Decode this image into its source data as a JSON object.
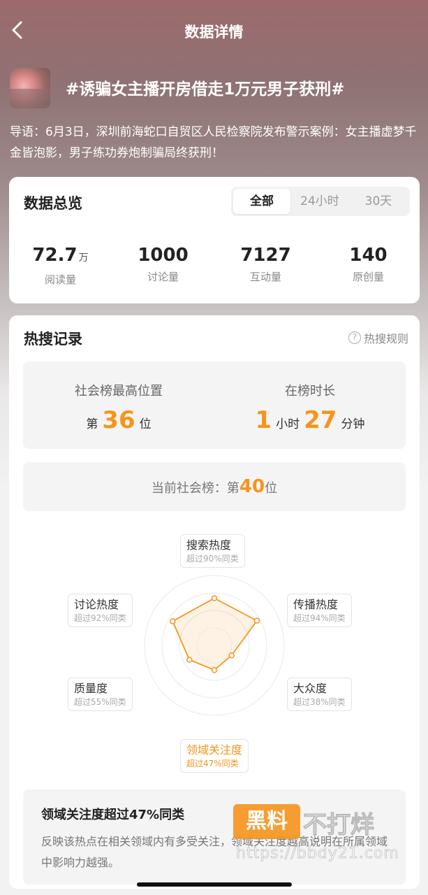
{
  "header": {
    "title": "数据详情"
  },
  "topic": {
    "title": "#诱骗女主播开房借走1万元男子获刑#",
    "lead": "导语：6月3日，深圳前海蛇口自贸区人民检察院发布警示案例：女主播虚梦千金皆泡影，男子练功券炮制骗局终获刑！"
  },
  "overview": {
    "title": "数据总览",
    "tabs": [
      "全部",
      "24小时",
      "30天"
    ],
    "active_tab": "全部",
    "stats": [
      {
        "value": "72.7",
        "unit": "万",
        "label": "阅读量"
      },
      {
        "value": "1000",
        "unit": "",
        "label": "讨论量"
      },
      {
        "value": "7127",
        "unit": "",
        "label": "互动量"
      },
      {
        "value": "140",
        "unit": "",
        "label": "原创量"
      }
    ]
  },
  "hot": {
    "title": "热搜记录",
    "rule_label": "热搜规则",
    "peak": {
      "label": "社会榜最高位置",
      "prefix": "第",
      "value": "36",
      "suffix": "位"
    },
    "duration": {
      "label": "在榜时长",
      "hours": "1",
      "hours_unit": "小时",
      "minutes": "27",
      "minutes_unit": "分钟"
    },
    "current": {
      "prefix": "当前社会榜：第",
      "value": "40",
      "suffix": "位"
    },
    "radar": [
      {
        "name": "搜索热度",
        "sub": "超过90%同类",
        "pct": 90
      },
      {
        "name": "传播热度",
        "sub": "超过94%同类",
        "pct": 94
      },
      {
        "name": "大众度",
        "sub": "超过38%同类",
        "pct": 38
      },
      {
        "name": "领域关注度",
        "sub": "超过47%同类",
        "pct": 47,
        "highlight": true
      },
      {
        "name": "质量度",
        "sub": "超过55%同类",
        "pct": 55
      },
      {
        "name": "讨论热度",
        "sub": "超过92%同类",
        "pct": 92
      }
    ],
    "detail": {
      "title": "领域关注度超过47%同类",
      "desc": "反映该热点在相关领域内有多受关注，领域关注度越高说明在所属领域中影响力越强。"
    }
  },
  "watermark": {
    "line1": "黑料",
    "line2": "不打烊",
    "line3": "https://bbdy21.com"
  },
  "colors": {
    "accent": "#f7941d"
  }
}
